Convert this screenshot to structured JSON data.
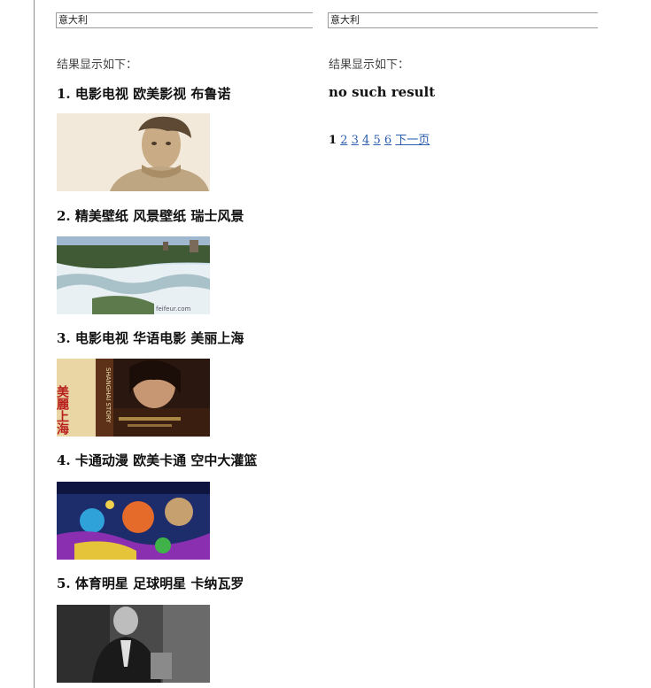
{
  "left_panel": {
    "search_value": "意大利",
    "result_label": "结果显示如下：",
    "results": [
      {
        "title": "1. 电影电视 欧美影视 布鲁诺"
      },
      {
        "title": "2. 精美壁纸 风景壁纸 瑞士风景",
        "watermark": "feifeur.com"
      },
      {
        "title": "3. 电影电视 华语电影 美丽上海",
        "poster_text": "美麗上海",
        "poster_subtitle": "SHANGHAI STORY"
      },
      {
        "title": "4. 卡通动漫 欧美卡通 空中大灌篮"
      },
      {
        "title": "5. 体育明星 足球明星 卡纳瓦罗"
      }
    ]
  },
  "right_panel": {
    "search_value": "意大利",
    "result_label": "结果显示如下：",
    "no_result_text": "no such result",
    "pagination": {
      "current": "1",
      "pages": [
        "2",
        "3",
        "4",
        "5",
        "6"
      ],
      "next_label": "下一页"
    }
  }
}
